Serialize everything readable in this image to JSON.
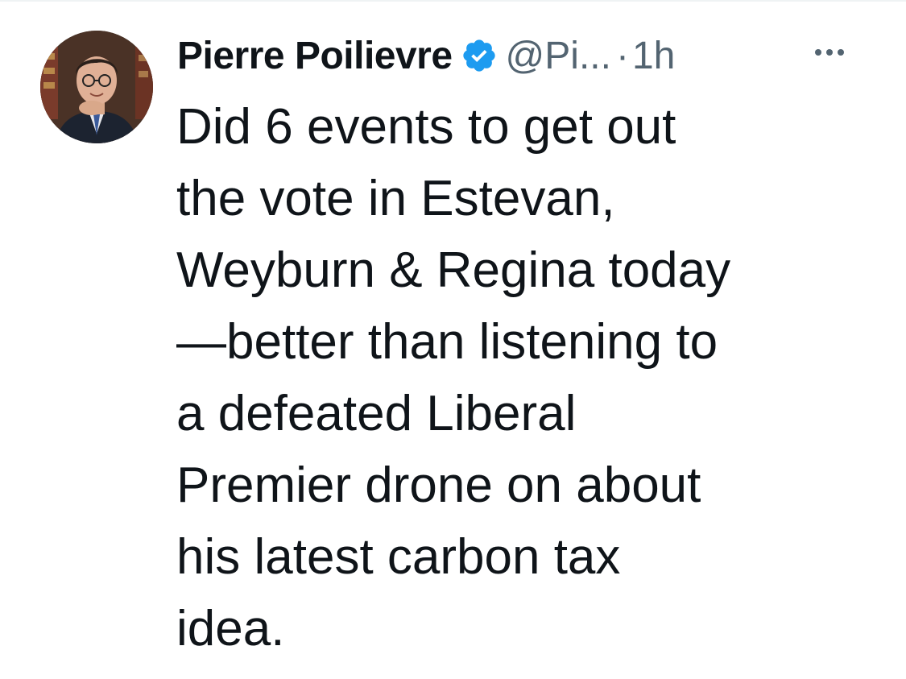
{
  "tweet": {
    "author": {
      "display_name": "Pierre Poilievre",
      "handle": "@Pi...",
      "verified": true,
      "verified_icon": "verified-badge-icon"
    },
    "separator": "·",
    "timestamp": "1h",
    "more_icon": "more-options-icon",
    "text_lines": [
      "Did 6 events to get out",
      "the vote in Estevan,",
      "Weyburn & Regina today",
      "—better than listening to",
      "a defeated Liberal",
      "Premier drone on about",
      "his latest carbon tax",
      "idea."
    ]
  },
  "colors": {
    "text_primary": "#0f1419",
    "text_secondary": "#536471",
    "verified_blue": "#1d9bf0",
    "background": "#ffffff"
  }
}
